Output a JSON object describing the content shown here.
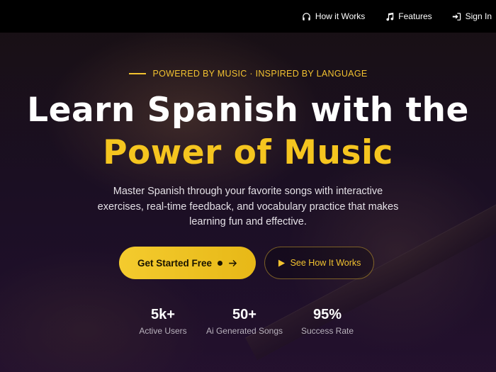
{
  "nav": {
    "items": [
      {
        "label": "How it Works",
        "icon": "headphones-icon"
      },
      {
        "label": "Features",
        "icon": "music-note-icon"
      },
      {
        "label": "Sign In",
        "icon": "sign-in-icon"
      }
    ]
  },
  "hero": {
    "tagline": "POWERED BY MUSIC · INSPIRED BY LANGUAGE",
    "headline_line1": "Learn Spanish with the",
    "headline_line2": "Power of Music",
    "subtext": "Master Spanish through your favorite songs with interactive exercises, real-time feedback, and vocabulary practice that makes learning fun and effective.",
    "primary_cta": "Get Started Free",
    "secondary_cta": "See How It Works"
  },
  "stats": [
    {
      "value": "5k+",
      "label": "Active Users"
    },
    {
      "value": "50+",
      "label": "Ai Generated Songs"
    },
    {
      "value": "95%",
      "label": "Success Rate"
    }
  ],
  "colors": {
    "accent": "#f5c51f",
    "nav_bg": "#000000",
    "hero_bg": "#1a1022"
  }
}
